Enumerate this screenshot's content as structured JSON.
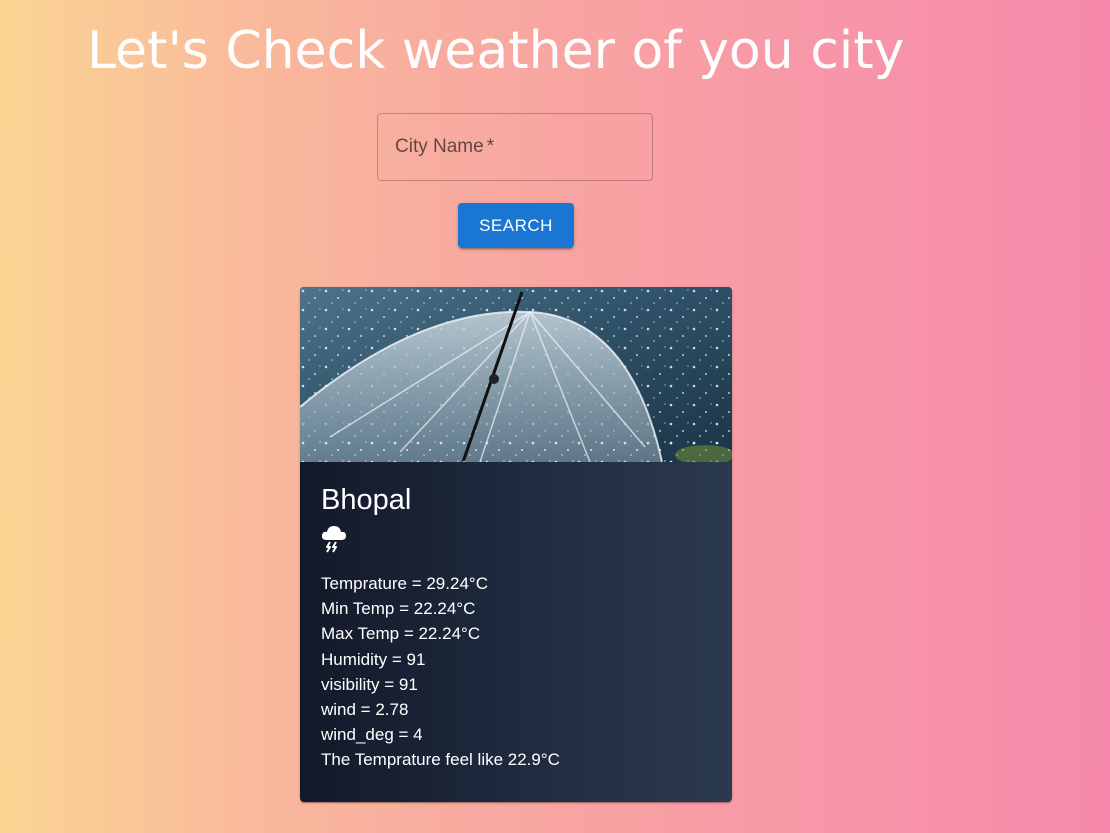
{
  "header": {
    "title": "Let's Check weather of you city"
  },
  "search": {
    "label": "City Name",
    "required_marker": "*",
    "value": "",
    "button_label": "SEARCH"
  },
  "card": {
    "image": "rain-umbrella-photo",
    "city": "Bhopal",
    "weather_icon": "thunderstorm-icon",
    "details": {
      "temperature": "Temprature = 29.24°C",
      "min_temp": "Min Temp = 22.24°C",
      "max_temp": "Max Temp = 22.24°C",
      "humidity": "Humidity = 91",
      "visibility": "visibility = 91",
      "wind": "wind = 2.78",
      "wind_deg": "wind_deg = 4",
      "feels_like": "The Temprature feel like 22.9°C"
    }
  },
  "colors": {
    "background_start": "#fbd493",
    "background_end": "#f689ab",
    "button": "#1976d2",
    "card_start": "#121929",
    "card_end": "#2c3a4e"
  }
}
